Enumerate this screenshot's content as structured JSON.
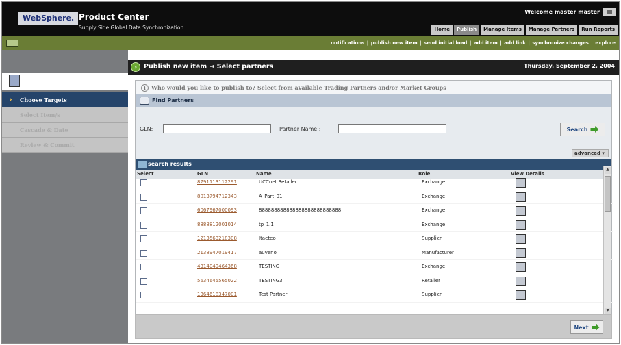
{
  "header": {
    "brand": "WebSphere.",
    "product": "Product Center",
    "tagline": "Supply Side Global Data Synchronization",
    "welcome": "Welcome  master master",
    "tabs": [
      "Home",
      "Publish",
      "Manage Items",
      "Manage Partners",
      "Run Reports"
    ],
    "active_tab": "Publish"
  },
  "actions": [
    "notifications",
    "publish new item",
    "send initial load",
    "add item",
    "add link",
    "synchronize changes",
    "explore"
  ],
  "page": {
    "title": "Publish new item  →  Select partners",
    "date": "Thursday, September 2, 2004"
  },
  "sidebar": {
    "steps": [
      "Choose Targets",
      "Select Item/s",
      "Cascade & Date",
      "Review & Commit"
    ]
  },
  "info_text": "Who would you like to publish to? Select from available Trading Partners and/or Market Groups",
  "find": {
    "title": "Find Partners",
    "gln_label": "GLN:",
    "partner_label": "Partner Name :",
    "search_label": "Search",
    "advanced_label": "advanced"
  },
  "results": {
    "title": "search results",
    "columns": [
      "Select",
      "GLN",
      "Name",
      "Role",
      "View Details"
    ],
    "rows": [
      {
        "gln": "8791113112291",
        "name": "UCCnet Retailer",
        "role": "Exchange"
      },
      {
        "gln": "8013794712343",
        "name": "A_Part_01",
        "role": "Exchange"
      },
      {
        "gln": "6067967000093",
        "name": "888888888888888888888888888",
        "role": "Exchange"
      },
      {
        "gln": "8888812001014",
        "name": "tp_1.1",
        "role": "Exchange"
      },
      {
        "gln": "1213563218308",
        "name": "Itaeteo",
        "role": "Supplier"
      },
      {
        "gln": "2138947019417",
        "name": "auveno",
        "role": "Manufacturer"
      },
      {
        "gln": "4314049464368",
        "name": "TESTING",
        "role": "Exchange"
      },
      {
        "gln": "5634645565022",
        "name": "TESTING3",
        "role": "Retailer"
      },
      {
        "gln": "1364618347001",
        "name": "Test Partner",
        "role": "Supplier"
      }
    ]
  },
  "next_label": "Next"
}
